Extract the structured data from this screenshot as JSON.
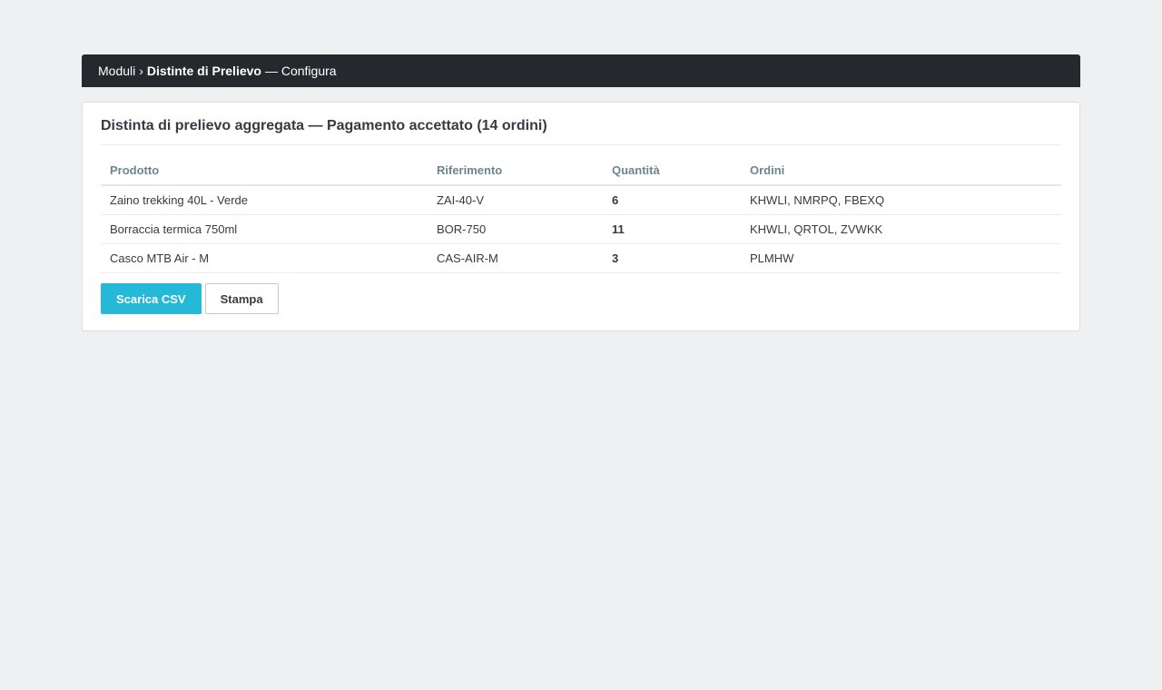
{
  "breadcrumb": {
    "root": "Moduli",
    "separator": "›",
    "current": "Distinte di Prelievo",
    "suffix": "— Configura"
  },
  "panel": {
    "title": "Distinta di prelievo aggregata — Pagamento accettato (14 ordini)"
  },
  "table": {
    "headers": {
      "product": "Prodotto",
      "reference": "Riferimento",
      "quantity": "Quantità",
      "orders": "Ordini"
    },
    "rows": [
      {
        "product": "Zaino trekking 40L - Verde",
        "reference": "ZAI-40-V",
        "quantity": "6",
        "orders": "KHWLI, NMRPQ, FBEXQ"
      },
      {
        "product": "Borraccia termica 750ml",
        "reference": "BOR-750",
        "quantity": "11",
        "orders": "KHWLI, QRTOL, ZVWKK"
      },
      {
        "product": "Casco MTB Air - M",
        "reference": "CAS-AIR-M",
        "quantity": "3",
        "orders": "PLMHW"
      }
    ]
  },
  "actions": {
    "download_csv": "Scarica CSV",
    "print": "Stampa"
  },
  "colors": {
    "topbar": "#25282c",
    "accent": "#25b9d7",
    "background": "#eff0f2",
    "header_text": "#6c868e"
  }
}
